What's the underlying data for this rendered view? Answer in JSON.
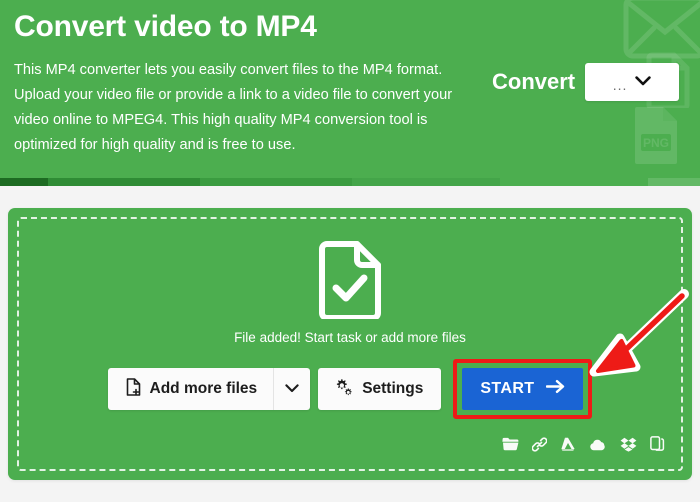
{
  "hero": {
    "title": "Convert video to MP4",
    "description": "This MP4 converter lets you easily convert files to the MP4 format. Upload your video file or provide a link to a video file to convert your video online to MPEG4. This high quality MP4 conversion tool is optimized for high quality and is free to use.",
    "convert_label": "Convert",
    "dropdown_value": "...",
    "dropdown_icon": "chevron-down-icon",
    "watermarks": [
      "envelope-icon",
      "file-icon",
      "png-file-icon"
    ],
    "background_color": "#4cae4f"
  },
  "card": {
    "status_text": "File added! Start task or add more files",
    "file_icon": "file-check-icon",
    "buttons": {
      "add_more_files": "Add more files",
      "add_more_files_icon": "file-add-icon",
      "add_more_files_caret_icon": "chevron-down-icon",
      "settings": "Settings",
      "settings_icon": "gears-icon",
      "start": "START",
      "start_icon": "arrow-right-icon"
    },
    "source_icons": [
      "folder-icon",
      "link-icon",
      "google-drive-icon",
      "onedrive-icon",
      "dropbox-icon",
      "device-copy-icon"
    ],
    "background_color": "#4cae4f",
    "start_button_color": "#1a64d4",
    "highlight_color": "#ee1b17"
  },
  "annotation": {
    "arrow": "red-arrow-pointing-to-start",
    "color": "#ee1b17"
  }
}
